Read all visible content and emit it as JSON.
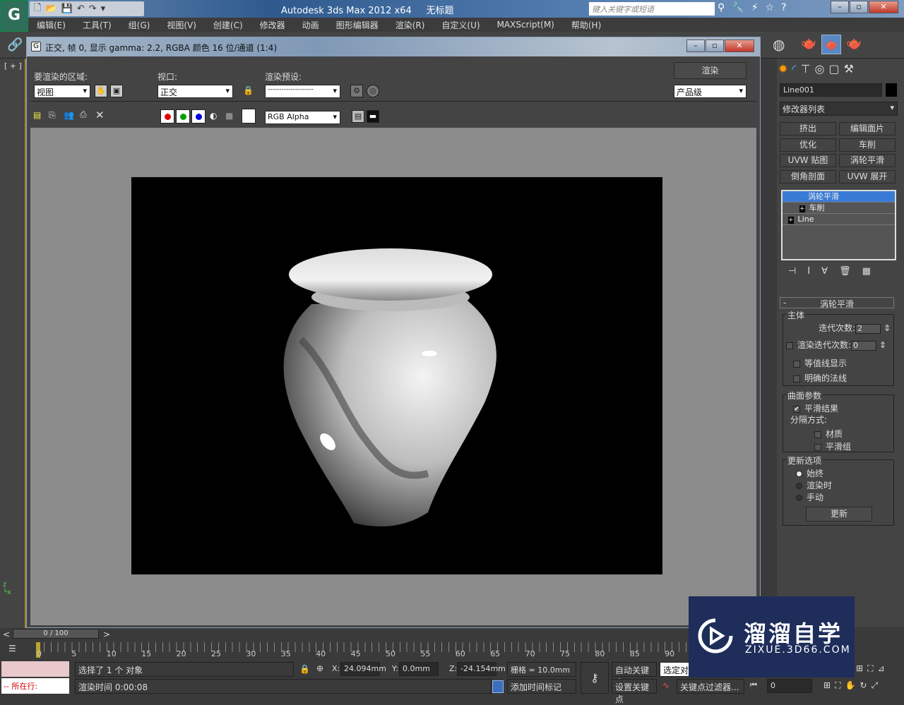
{
  "app": {
    "title": "Autodesk 3ds Max  2012 x64",
    "doc": "无标题",
    "logo": "G",
    "search_placeholder": "键入关键字或短语"
  },
  "menu": [
    "编辑(E)",
    "工具(T)",
    "组(G)",
    "视图(V)",
    "创建(C)",
    "修改器",
    "动画",
    "图形编辑器",
    "渲染(R)",
    "自定义(U)",
    "MAXScript(M)",
    "帮助(H)"
  ],
  "viewport_label": "[ + ]",
  "render_window": {
    "title": "正交, 帧 0, 显示 gamma: 2.2, RGBA 颜色 16 位/通道 (1:4)",
    "area_label": "要渲染的区域:",
    "area_value": "视图",
    "viewport_label": "视口:",
    "viewport_value": "正交",
    "preset_label": "渲染预设:",
    "preset_value": "--------------------",
    "render_button": "渲染",
    "quality_value": "产品级",
    "channel_value": "RGB Alpha",
    "channel_colors": {
      "red": "#e00000",
      "green": "#00a000",
      "blue": "#0000e0"
    }
  },
  "right_panel": {
    "object_name": "Line001",
    "modifier_list": "修改器列表",
    "modifier_buttons": [
      "挤出",
      "编辑面片",
      "优化",
      "车削",
      "UVW 贴图",
      "涡轮平滑",
      "倒角剖面",
      "UVW 展开"
    ],
    "stack": [
      "涡轮平滑",
      "车削",
      "Line"
    ],
    "rollout_title": "涡轮平滑",
    "main_group": "主体",
    "iterations_label": "迭代次数:",
    "iterations_value": "2",
    "render_iters_label": "渲染迭代次数:",
    "render_iters_value": "0",
    "isoline": "等值线显示",
    "explicit_normals": "明确的法线",
    "surface_group": "曲面参数",
    "smooth_result": "平滑结果",
    "separate_by": "分隔方式:",
    "material": "材质",
    "smoothing_groups": "平滑组",
    "update_group": "更新选项",
    "always": "始终",
    "when_rendering": "渲染时",
    "manually": "手动",
    "update_button": "更新"
  },
  "timeline": {
    "frame": "0 / 100",
    "ticks": [
      "0",
      "5",
      "10",
      "15",
      "20",
      "25",
      "30",
      "35",
      "40",
      "45",
      "50",
      "55",
      "60",
      "65",
      "70",
      "75",
      "80",
      "85",
      "90"
    ]
  },
  "status": {
    "script_label": "-- 所在行:",
    "selected": "选择了 1 个 对象",
    "render_time": "渲染时间 0:00:08",
    "x_label": "X:",
    "x": "24.094mm",
    "y_label": "Y:",
    "y": "0.0mm",
    "z_label": "Z:",
    "z": "-24.154mm",
    "grid": "栅格 = 10.0mm",
    "add_tag": "添加时间标记",
    "auto_key": "自动关键点",
    "set_key": "设置关键点",
    "selected_obj": "选定对",
    "key_filter": "关键点过滤器...",
    "frame_field": "0"
  },
  "watermark": {
    "name": "溜溜自学",
    "url": "ZIXUE.3D66.COM"
  }
}
